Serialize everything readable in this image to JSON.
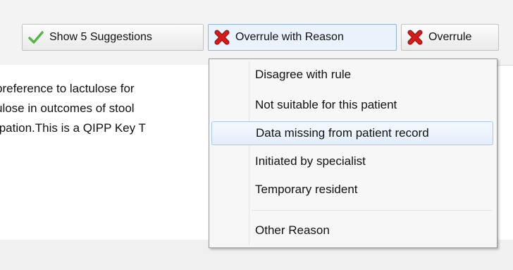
{
  "toolbar": {
    "buttons": [
      {
        "label": "Show 5 Suggestions",
        "icon": "check-icon"
      },
      {
        "label": "Overrule with Reason",
        "icon": "red-x-icon"
      },
      {
        "label": "Overrule",
        "icon": "red-x-icon"
      }
    ]
  },
  "body": {
    "lines": [
      "preference to lactulose for",
      "ulose in outcomes of stool",
      ":pation.This is a QIPP Key T"
    ]
  },
  "menu": {
    "items": [
      "Disagree with rule",
      "Not suitable for this patient",
      "Data missing from patient record",
      "Initiated by specialist",
      "Temporary resident"
    ],
    "other": "Other Reason",
    "highlighted_index": 2
  },
  "colors": {
    "check": "#5ab34a",
    "x_red": "#d21b1b",
    "highlight_border": "#a8c8ee"
  }
}
